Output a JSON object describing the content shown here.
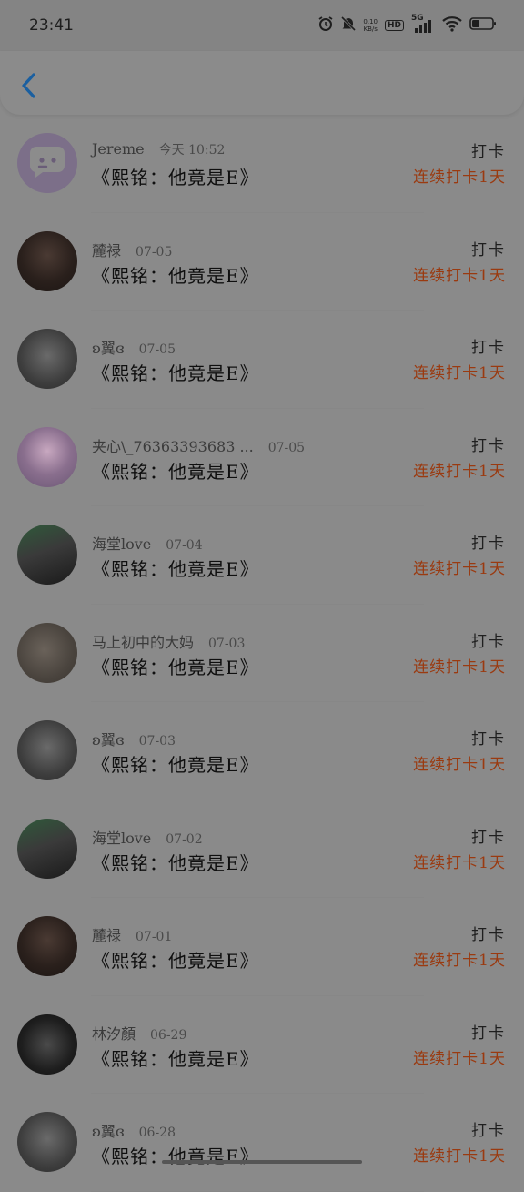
{
  "status_bar": {
    "time": "23:41",
    "net_speed_top": "0.10",
    "net_speed_bottom": "KB/s",
    "hd": "HD",
    "network": "5G"
  },
  "colors": {
    "overlay_bg": "#8a8a8a",
    "streak": "#9a3a10",
    "back_arrow": "#1a5fa0"
  },
  "rows": [
    {
      "name": "Jereme",
      "date": "今天 10:52",
      "title": "《熙铭：他竟是E》",
      "checkin": "打卡",
      "streak": "连续打卡1天",
      "avatar": "chat-bubble"
    },
    {
      "name": "麓禄",
      "date": "07-05",
      "title": "《熙铭：他竟是E》",
      "checkin": "打卡",
      "streak": "连续打卡1天",
      "avatar": "photo"
    },
    {
      "name": "ʚ翼ɞ",
      "date": "07-05",
      "title": "《熙铭：他竟是E》",
      "checkin": "打卡",
      "streak": "连续打卡1天",
      "avatar": "photo"
    },
    {
      "name": "夹心\\_76363393683 ...",
      "date": "07-05",
      "title": "《熙铭：他竟是E》",
      "checkin": "打卡",
      "streak": "连续打卡1天",
      "avatar": "photo"
    },
    {
      "name": "海堂love",
      "date": "07-04",
      "title": "《熙铭：他竟是E》",
      "checkin": "打卡",
      "streak": "连续打卡1天",
      "avatar": "photo"
    },
    {
      "name": "马上初中的大妈",
      "date": "07-03",
      "title": "《熙铭：他竟是E》",
      "checkin": "打卡",
      "streak": "连续打卡1天",
      "avatar": "photo"
    },
    {
      "name": "ʚ翼ɞ",
      "date": "07-03",
      "title": "《熙铭：他竟是E》",
      "checkin": "打卡",
      "streak": "连续打卡1天",
      "avatar": "photo"
    },
    {
      "name": "海堂love",
      "date": "07-02",
      "title": "《熙铭：他竟是E》",
      "checkin": "打卡",
      "streak": "连续打卡1天",
      "avatar": "photo"
    },
    {
      "name": "麓禄",
      "date": "07-01",
      "title": "《熙铭：他竟是E》",
      "checkin": "打卡",
      "streak": "连续打卡1天",
      "avatar": "photo"
    },
    {
      "name": "林汐顏",
      "date": "06-29",
      "title": "《熙铭：他竟是E》",
      "checkin": "打卡",
      "streak": "连续打卡1天",
      "avatar": "photo"
    },
    {
      "name": "ʚ翼ɞ",
      "date": "06-28",
      "title": "《熙铭：他竟是E》",
      "checkin": "打卡",
      "streak": "连续打卡1天",
      "avatar": "photo"
    }
  ]
}
